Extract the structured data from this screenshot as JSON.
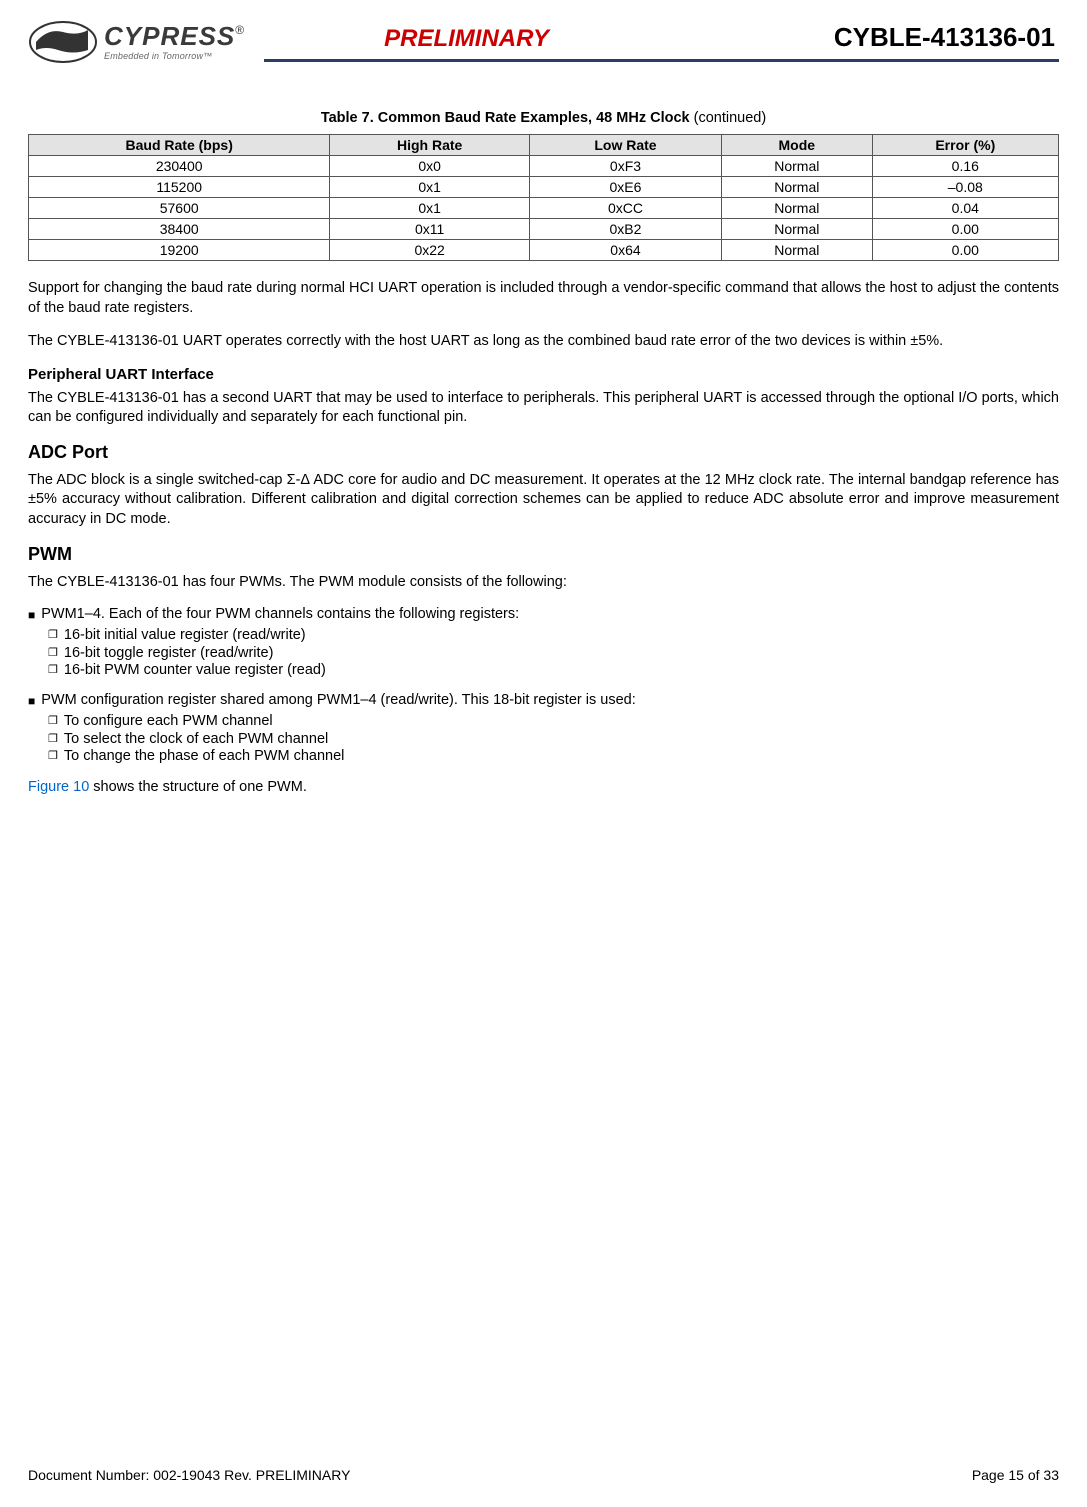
{
  "header": {
    "brand_name": "CYPRESS",
    "brand_reg": "®",
    "tagline": "Embedded in Tomorrow™",
    "preliminary": "PRELIMINARY",
    "part_number": "CYBLE-413136-01"
  },
  "table": {
    "caption_prefix": "Table 7.  Common Baud Rate Examples, 48 MHz Clock",
    "caption_suffix": " (continued)",
    "headers": [
      "Baud Rate (bps)",
      "High Rate",
      "Low Rate",
      "Mode",
      "Error (%)"
    ],
    "rows": [
      [
        "230400",
        "0x0",
        "0xF3",
        "Normal",
        "0.16"
      ],
      [
        "115200",
        "0x1",
        "0xE6",
        "Normal",
        "–0.08"
      ],
      [
        "57600",
        "0x1",
        "0xCC",
        "Normal",
        "0.04"
      ],
      [
        "38400",
        "0x11",
        "0xB2",
        "Normal",
        "0.00"
      ],
      [
        "19200",
        "0x22",
        "0x64",
        "Normal",
        "0.00"
      ]
    ]
  },
  "paragraphs": {
    "p1": "Support for changing the baud rate during normal HCI UART operation is included through a vendor-specific command that allows the host to adjust the contents of the baud rate registers.",
    "p2": "The CYBLE-413136-01 UART operates correctly with the host UART as long as the combined baud rate error of the two devices is within ±5%.",
    "sub1_title": "Peripheral UART Interface",
    "sub1_body": "The CYBLE-413136-01 has a second UART that may be used to interface to peripherals. This peripheral UART is accessed through the optional I/O ports, which can be configured individually and separately for each functional pin.",
    "adc_title": "ADC Port",
    "adc_body": "The ADC block is a single switched-cap Σ-Δ ADC core for audio and DC measurement. It operates at the 12 MHz clock rate. The internal bandgap reference has ±5% accuracy without calibration. Different calibration and digital correction schemes can be applied to reduce ADC absolute error and improve measurement accuracy in DC mode.",
    "pwm_title": "PWM",
    "pwm_intro": "The CYBLE-413136-01 has four PWMs. The PWM module consists of the following:",
    "b1": "PWM1–4. Each of the four PWM channels contains the following registers:",
    "b1a": "16-bit initial value register (read/write)",
    "b1b": "16-bit toggle register (read/write)",
    "b1c": "16-bit PWM counter value register (read)",
    "b2": "PWM configuration register shared among PWM1–4 (read/write). This 18-bit register is used:",
    "b2a": "To configure each PWM channel",
    "b2b": "To select the clock of each PWM channel",
    "b2c": "To change the phase of each PWM channel",
    "figref_link": "Figure 10",
    "figref_rest": " shows the structure of one PWM."
  },
  "footer": {
    "docnum": "Document Number:  002-19043 Rev. PRELIMINARY",
    "page": "Page 15 of 33"
  }
}
